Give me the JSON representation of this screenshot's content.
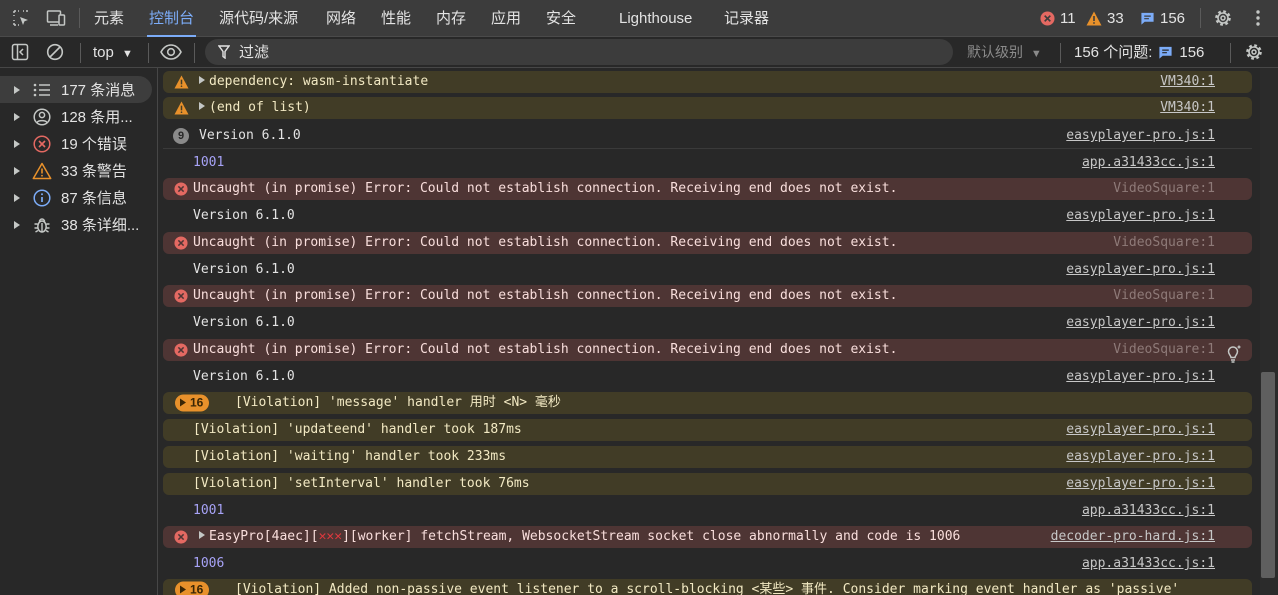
{
  "tabs": [
    {
      "label": "元素"
    },
    {
      "label": "控制台"
    },
    {
      "label": "源代码/来源"
    },
    {
      "label": "网络"
    },
    {
      "label": "性能"
    },
    {
      "label": "内存"
    },
    {
      "label": "应用"
    },
    {
      "label": "安全"
    },
    {
      "label": "Lighthouse"
    },
    {
      "label": "记录器"
    }
  ],
  "counts": {
    "errors": "11",
    "warnings": "33",
    "messages": "156"
  },
  "toolbar": {
    "context": "top",
    "filter_placeholder": "过滤",
    "level": "默认级别",
    "issues_label": "156 个问题:",
    "issues_count": "156"
  },
  "sidebar": {
    "items": [
      {
        "label": "177 条消息",
        "icon": "list-icon"
      },
      {
        "label": "128 条用...",
        "icon": "user-icon"
      },
      {
        "label": "19 个错误",
        "icon": "error-icon"
      },
      {
        "label": "33 条警告",
        "icon": "warning-icon"
      },
      {
        "label": "87 条信息",
        "icon": "info-icon"
      },
      {
        "label": "38 条详细...",
        "icon": "bug-icon"
      }
    ]
  },
  "console": {
    "rows": [
      {
        "type": "warn",
        "text": "dependency: wasm-instantiate",
        "source": "VM340:1"
      },
      {
        "type": "warn",
        "text": "(end of list)",
        "source": "VM340:1"
      },
      {
        "type": "group",
        "count": "9",
        "text": "Version 6.1.0",
        "source": "easyplayer-pro.js:1"
      },
      {
        "type": "num",
        "text": "1001",
        "source": "app.a31433cc.js:1"
      },
      {
        "type": "err",
        "text": "Uncaught (in promise) Error: Could not establish connection. Receiving end does not exist.",
        "source": "VideoSquare:1"
      },
      {
        "type": "info",
        "text": "Version 6.1.0",
        "source": "easyplayer-pro.js:1"
      },
      {
        "type": "err",
        "text": "Uncaught (in promise) Error: Could not establish connection. Receiving end does not exist.",
        "source": "VideoSquare:1"
      },
      {
        "type": "info",
        "text": "Version 6.1.0",
        "source": "easyplayer-pro.js:1"
      },
      {
        "type": "err",
        "text": "Uncaught (in promise) Error: Could not establish connection. Receiving end does not exist.",
        "source": "VideoSquare:1"
      },
      {
        "type": "info",
        "text": "Version 6.1.0",
        "source": "easyplayer-pro.js:1"
      },
      {
        "type": "err",
        "text": "Uncaught (in promise) Error: Could not establish connection. Receiving end does not exist.",
        "source": "VideoSquare:1"
      },
      {
        "type": "info",
        "text": "Version 6.1.0",
        "source": "easyplayer-pro.js:1"
      },
      {
        "type": "warn-group",
        "count": "16",
        "text": "[Violation] 'message' handler 用时 <N> 毫秒",
        "source": ""
      },
      {
        "type": "warn-sub",
        "text": "[Violation] 'updateend' handler took 187ms",
        "source": "easyplayer-pro.js:1"
      },
      {
        "type": "warn-sub",
        "text": "[Violation] 'waiting' handler took 233ms",
        "source": "easyplayer-pro.js:1"
      },
      {
        "type": "warn-sub",
        "text": "[Violation] 'setInterval' handler took 76ms",
        "source": "easyplayer-pro.js:1"
      },
      {
        "type": "num",
        "text": "1001",
        "source": "app.a31433cc.js:1"
      },
      {
        "type": "err-expand",
        "text_before": "EasyPro[4aec][",
        "text_after": "][worker] fetchStream, WebsocketStream socket close abnormally and code is 1006",
        "source": "decoder-pro-hard.js:1"
      },
      {
        "type": "num",
        "text": "1006",
        "source": "app.a31433cc.js:1"
      },
      {
        "type": "warn-group",
        "count": "16",
        "text": "[Violation] Added non-passive event listener to a scroll-blocking <某些> 事件. Consider marking event handler as 'passive'",
        "source": ""
      }
    ]
  },
  "colors": {
    "accent": "#7cacf8",
    "error": "#e46962",
    "warning": "#e8912b",
    "message": "#7cacf8"
  }
}
